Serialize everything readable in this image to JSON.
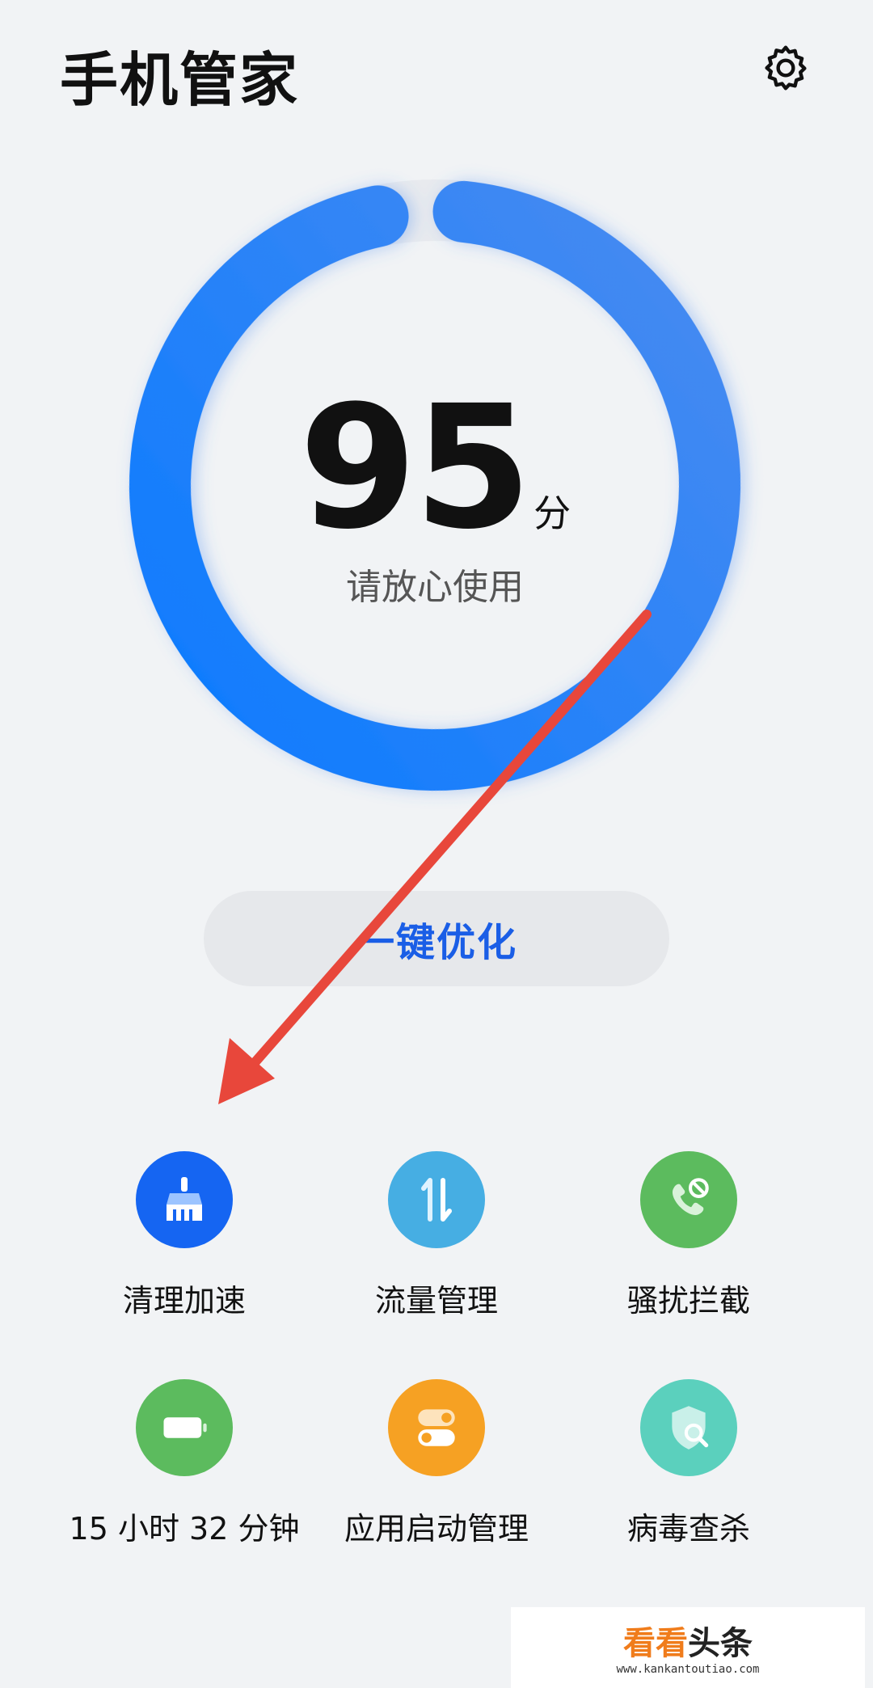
{
  "header": {
    "title": "手机管家",
    "settings_icon": "gear-icon"
  },
  "score": {
    "value": "95",
    "unit": "分",
    "status": "请放心使用",
    "percent": 95,
    "ring_color_start": "#0a7bff",
    "ring_color_end": "#4a8bf0",
    "track_color": "#e8eaee"
  },
  "optimize": {
    "label": "一键优化",
    "text_color": "#1a5ee6"
  },
  "features": [
    {
      "label": "清理加速",
      "icon": "broom-icon",
      "color": "#1565f2"
    },
    {
      "label": "流量管理",
      "icon": "data-transfer-icon",
      "color": "#46aee3"
    },
    {
      "label": "骚扰拦截",
      "icon": "phone-block-icon",
      "color": "#5cbb5e"
    },
    {
      "label": "15 小时 32 分钟",
      "icon": "battery-icon",
      "color": "#5cbb5e"
    },
    {
      "label": "应用启动管理",
      "icon": "app-launch-toggle-icon",
      "color": "#f6a123"
    },
    {
      "label": "病毒查杀",
      "icon": "virus-scan-shield-icon",
      "color": "#5bd0bd"
    }
  ],
  "annotation": {
    "arrow_color": "#e8473b",
    "arrow_icon": "red-arrow-icon"
  },
  "watermark": {
    "brand_orange": "看看",
    "brand_dark": "头条",
    "url": "www.kankantoutiao.com"
  }
}
